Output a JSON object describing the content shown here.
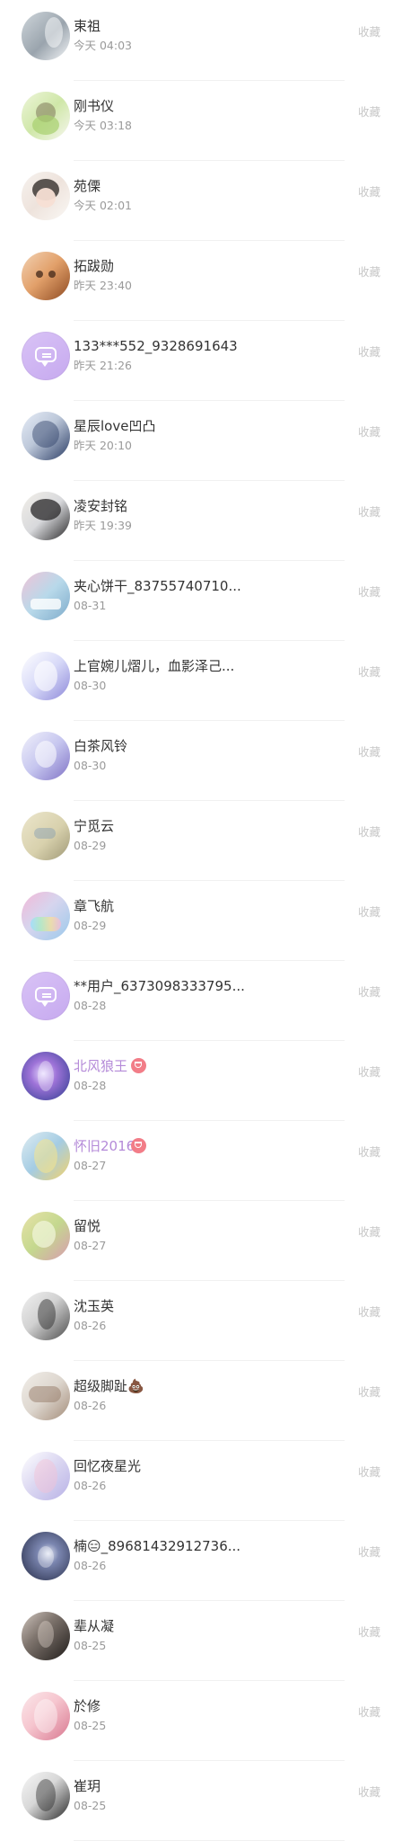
{
  "list": {
    "items": [
      {
        "name": "束祖",
        "time": "今天 04:03",
        "collect_label": "收藏",
        "avatar_type": "image",
        "avatar_colors": [
          "#cfd6db",
          "#7d8791",
          "#f4f6f8"
        ]
      },
      {
        "name": "刚书仪",
        "time": "今天 03:18",
        "collect_label": "收藏",
        "avatar_type": "image",
        "avatar_colors": [
          "#eef5da",
          "#a8d06f",
          "#6d5f47"
        ]
      },
      {
        "name": "苑傈",
        "time": "今天 02:01",
        "collect_label": "收藏",
        "avatar_type": "image",
        "avatar_colors": [
          "#f6f2ee",
          "#3f3a36",
          "#e7b3a2"
        ]
      },
      {
        "name": "拓跋勋",
        "time": "昨天 23:40",
        "collect_label": "收藏",
        "avatar_type": "image",
        "avatar_colors": [
          "#e2a06a",
          "#8e4a21",
          "#f2d2b4"
        ]
      },
      {
        "name": "133***552_9328691643",
        "time": "昨天 21:26",
        "collect_label": "收藏",
        "avatar_type": "chat",
        "avatar_colors": [
          "#d7c1f7",
          "#c4a3ef",
          "#ffffff"
        ]
      },
      {
        "name": "星辰love凹凸",
        "time": "昨天 20:10",
        "collect_label": "收藏",
        "avatar_type": "image",
        "avatar_colors": [
          "#bcc7d9",
          "#2c3e66",
          "#e7edf7"
        ]
      },
      {
        "name": "凌安封铭",
        "time": "昨天 19:39",
        "collect_label": "收藏",
        "avatar_type": "image",
        "avatar_colors": [
          "#d8d9dc",
          "#282728",
          "#f2efe9"
        ]
      },
      {
        "name": "夹心饼干_8375574071​0...",
        "time": "08-31",
        "collect_label": "收藏",
        "avatar_type": "image",
        "avatar_colors": [
          "#b8d9ea",
          "#f0c3d7",
          "#7daaca"
        ]
      },
      {
        "name": "上官婉儿熠儿，血影泽己...",
        "time": "08-30",
        "collect_label": "收藏",
        "avatar_type": "image",
        "avatar_colors": [
          "#d7d9f8",
          "#8d88d9",
          "#ffffff"
        ]
      },
      {
        "name": "白茶风铃",
        "time": "08-30",
        "collect_label": "收藏",
        "avatar_type": "image",
        "avatar_colors": [
          "#c6c6ef",
          "#7f72c5",
          "#f1f1fb"
        ]
      },
      {
        "name": "宁觅云",
        "time": "08-29",
        "collect_label": "收藏",
        "avatar_type": "image",
        "avatar_colors": [
          "#d8d1ad",
          "#9f9876",
          "#ece6cc"
        ]
      },
      {
        "name": "章飞航",
        "time": "08-29",
        "collect_label": "收藏",
        "avatar_type": "image",
        "avatar_colors": [
          "#d6d5ee",
          "#9bc9eb",
          "#f3b8d7"
        ]
      },
      {
        "name": "**用户_6373098333795...",
        "time": "08-28",
        "collect_label": "收藏",
        "avatar_type": "chat",
        "avatar_colors": [
          "#d7c1f7",
          "#c4a3ef",
          "#ffffff"
        ]
      },
      {
        "name": "北风狼王",
        "time": "08-28",
        "collect_label": "收藏",
        "avatar_type": "image",
        "avatar_colors": [
          "#2b3b8e",
          "#9e73d8",
          "#e7dbff"
        ],
        "vip": true
      },
      {
        "name": "怀旧2016",
        "time": "08-27",
        "collect_label": "收藏",
        "avatar_type": "image",
        "avatar_colors": [
          "#e0edf2",
          "#f3d26b",
          "#a4cce3"
        ],
        "vip": true
      },
      {
        "name": "留悦",
        "time": "08-27",
        "collect_label": "收藏",
        "avatar_type": "image",
        "avatar_colors": [
          "#e8e2a9",
          "#d99bb0",
          "#c4d88e"
        ]
      },
      {
        "name": "沈玉英",
        "time": "08-26",
        "collect_label": "收藏",
        "avatar_type": "image",
        "avatar_colors": [
          "#d1d1d1",
          "#4d4d4d",
          "#f1f1f1"
        ]
      },
      {
        "name": "超级脚趾💩",
        "time": "08-26",
        "collect_label": "收藏",
        "avatar_type": "image",
        "avatar_colors": [
          "#ddd6ce",
          "#a48d7a",
          "#f1eee9"
        ]
      },
      {
        "name": "回忆夜星光",
        "time": "08-26",
        "collect_label": "收藏",
        "avatar_type": "image",
        "avatar_colors": [
          "#ddd9f2",
          "#b8b2e6",
          "#f4c2d5"
        ]
      },
      {
        "name": "楠😑_89681432912736...",
        "time": "08-26",
        "collect_label": "收藏",
        "avatar_type": "image",
        "avatar_colors": [
          "#232944",
          "#7b86b0",
          "#e1e6f4"
        ]
      },
      {
        "name": "辈从凝",
        "time": "08-25",
        "collect_label": "收藏",
        "avatar_type": "image",
        "avatar_colors": [
          "#7e746d",
          "#201c1a",
          "#d0c5be"
        ]
      },
      {
        "name": "於修",
        "time": "08-25",
        "collect_label": "收藏",
        "avatar_type": "image",
        "avatar_colors": [
          "#f6c6cf",
          "#d87890",
          "#fbe7ea"
        ]
      },
      {
        "name": "崔玥",
        "time": "08-25",
        "collect_label": "收藏",
        "avatar_type": "image",
        "avatar_colors": [
          "#d7d7d7",
          "#2a2a2a",
          "#f7f7f7"
        ]
      }
    ]
  }
}
